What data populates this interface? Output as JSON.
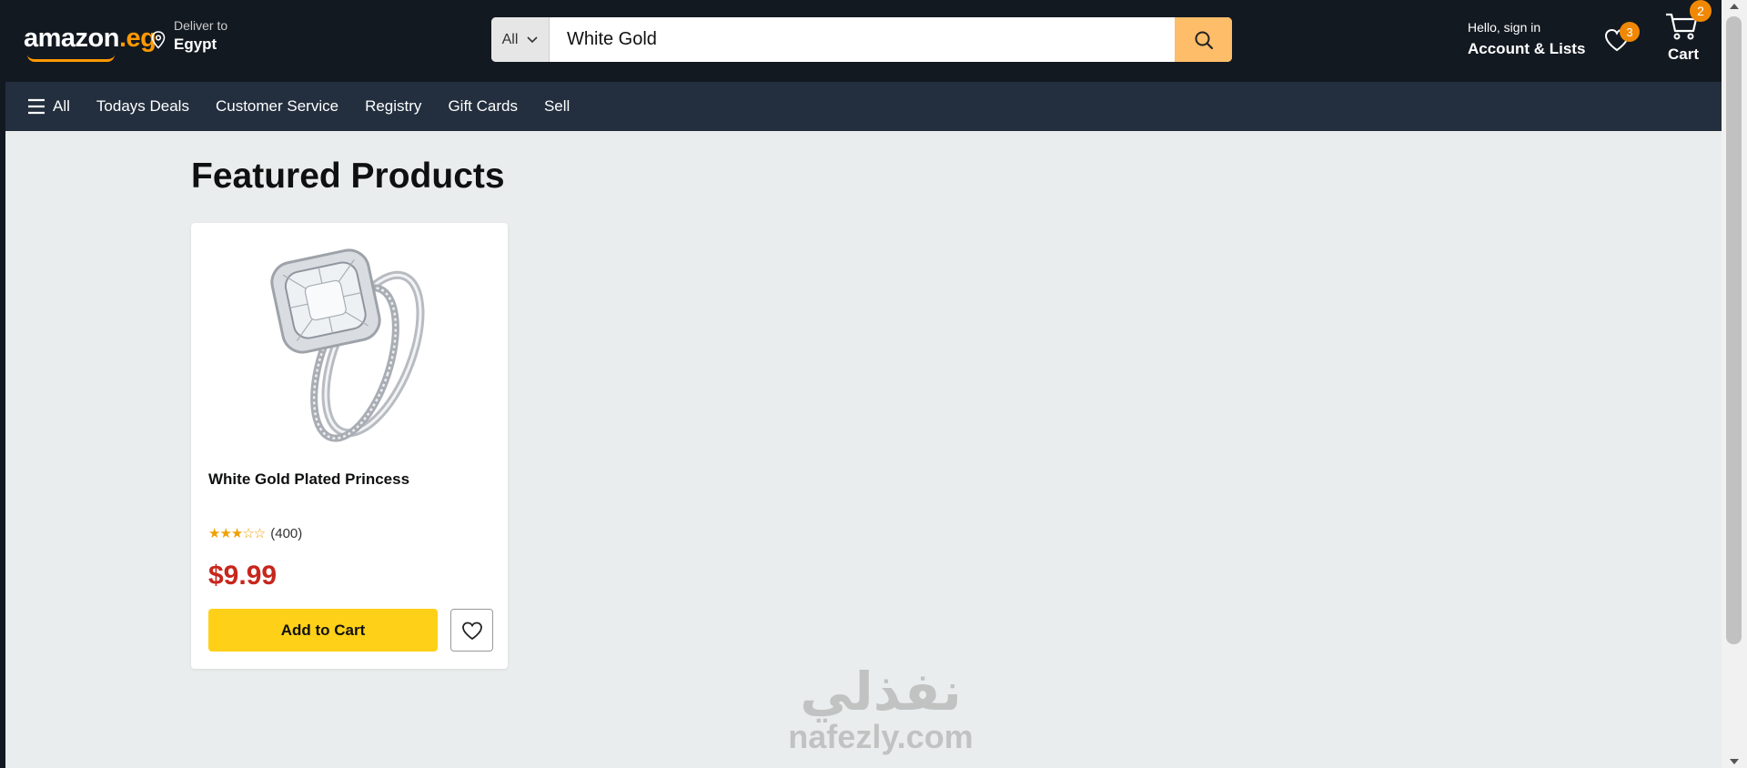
{
  "header": {
    "logo_main": "amazon",
    "logo_tld": ".eg",
    "deliver_label": "Deliver to",
    "deliver_location": "Egypt",
    "search": {
      "category": "All",
      "value": "White Gold"
    },
    "account_greeting": "Hello, sign in",
    "account_label": "Account & Lists",
    "wishlist_count": "3",
    "cart_count": "2",
    "cart_label": "Cart"
  },
  "nav": {
    "all_label": "All",
    "items": [
      "Todays Deals",
      "Customer Service",
      "Registry",
      "Gift Cards",
      "Sell"
    ]
  },
  "main": {
    "title": "Featured Products",
    "products": [
      {
        "title": "White Gold Plated Princess",
        "rating": 3,
        "rating_max": 5,
        "stars": "★★★☆☆",
        "reviews": "(400)",
        "price": "$9.99",
        "add_label": "Add to Cart"
      }
    ]
  },
  "watermark": {
    "arabic": "نفذلي",
    "latin": "nafezly.com"
  },
  "colors": {
    "header_bg": "#131921",
    "nav_bg": "#232f3e",
    "accent": "#ff9900",
    "search_button": "#febd69",
    "add_button": "#ffd018",
    "price": "#c7261d"
  }
}
